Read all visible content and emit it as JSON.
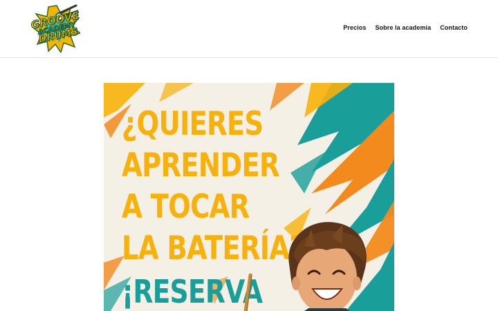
{
  "brand": {
    "logo_words": [
      "GROOVE",
      "ACADEMY",
      "DRUMS"
    ]
  },
  "nav": {
    "items": [
      {
        "label": "Precios"
      },
      {
        "label": "Sobre la academia"
      },
      {
        "label": "Contacto"
      }
    ]
  },
  "hero": {
    "headline_lines": [
      "¿QUIERES",
      "APRENDER",
      "A TOCAR",
      "LA BATERÍA?"
    ],
    "cta_text": "¡RESERVA",
    "colors": {
      "yellow": "#f7b10a",
      "teal": "#1a9e9a",
      "orange": "#f28a1e",
      "cream": "#f4f0e6"
    }
  }
}
